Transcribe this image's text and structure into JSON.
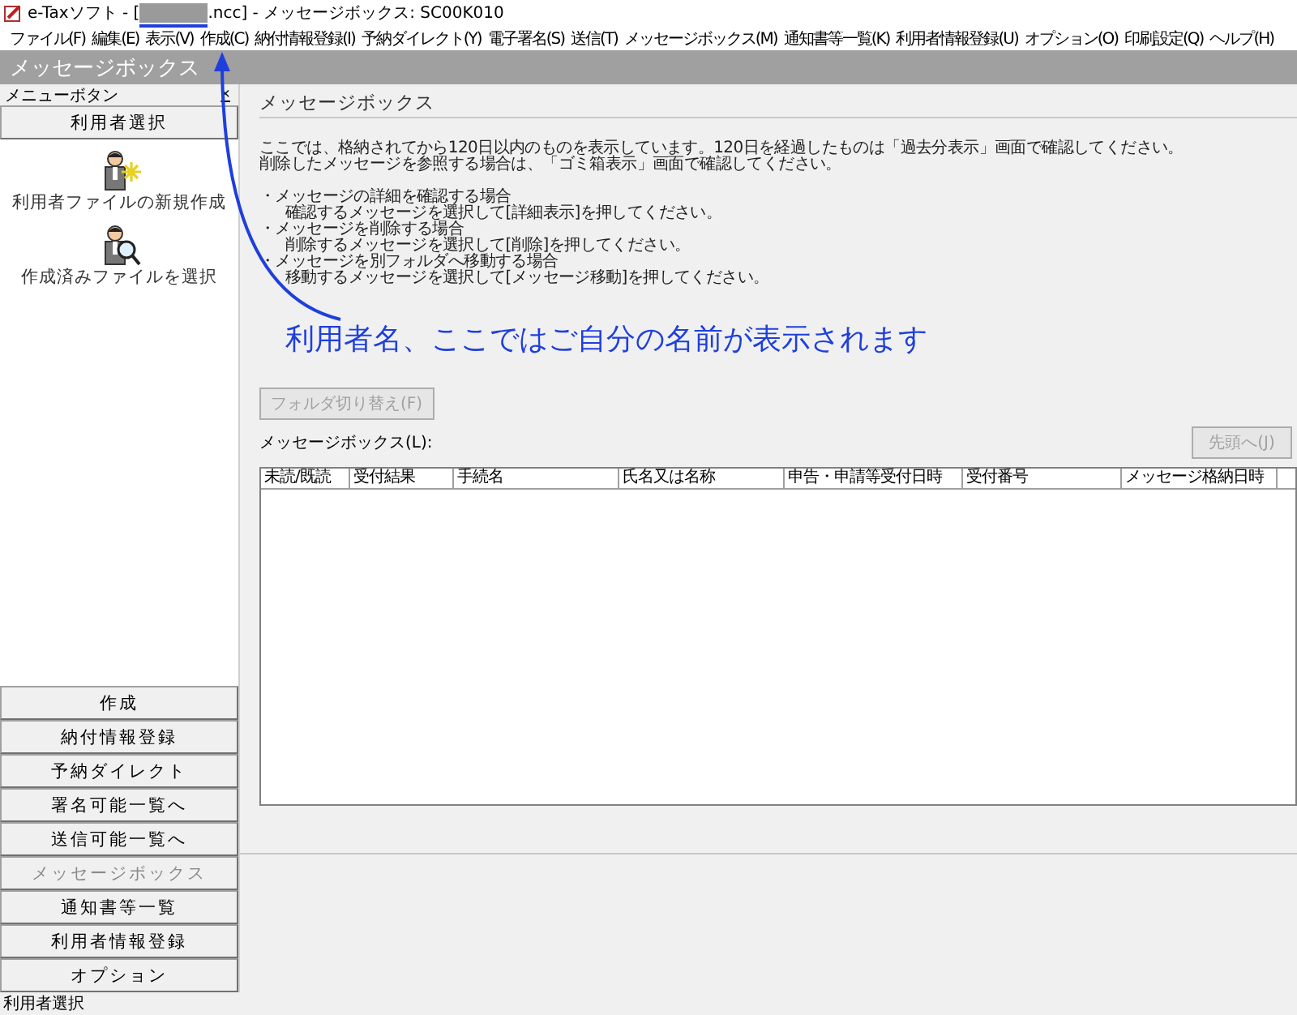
{
  "window": {
    "title_prefix": "e-Taxソフト - [",
    "title_suffix": ".ncc] - メッセージボックス: SC00K010"
  },
  "menu": [
    "ファイル(F)",
    "編集(E)",
    "表示(V)",
    "作成(C)",
    "納付情報登録(I)",
    "予納ダイレクト(Y)",
    "電子署名(S)",
    "送信(T)",
    "メッセージボックス(M)",
    "通知書等一覧(K)",
    "利用者情報登録(U)",
    "オプション(O)",
    "印刷設定(Q)",
    "ヘルプ(H)"
  ],
  "header": "メッセージボックス",
  "sidebar": {
    "label": "メニューボタン",
    "close": "×",
    "top_button": "利用者選択",
    "actions": [
      {
        "kind": "new",
        "label": "利用者ファイルの新規作成"
      },
      {
        "kind": "open",
        "label": "作成済みファイルを選択"
      }
    ],
    "buttons": [
      {
        "label": "作成",
        "disabled": false
      },
      {
        "label": "納付情報登録",
        "disabled": false
      },
      {
        "label": "予納ダイレクト",
        "disabled": false
      },
      {
        "label": "署名可能一覧へ",
        "disabled": false
      },
      {
        "label": "送信可能一覧へ",
        "disabled": false
      },
      {
        "label": "メッセージボックス",
        "disabled": true
      },
      {
        "label": "通知書等一覧",
        "disabled": false
      },
      {
        "label": "利用者情報登録",
        "disabled": false
      },
      {
        "label": "オプション",
        "disabled": false
      }
    ]
  },
  "main": {
    "title": "メッセージボックス",
    "intro": [
      "ここでは、格納されてから120日以内のものを表示しています。120日を経過したものは「過去分表示」画面で確認してください。",
      "削除したメッセージを参照する場合は、「ゴミ箱表示」画面で確認してください。"
    ],
    "bullets": [
      {
        "heading": "・メッセージの詳細を確認する場合",
        "detail": "確認するメッセージを選択して[詳細表示]を押してください。"
      },
      {
        "heading": "・メッセージを削除する場合",
        "detail": "削除するメッセージを選択して[削除]を押してください。"
      },
      {
        "heading": "・メッセージを別フォルダへ移動する場合",
        "detail": "移動するメッセージを選択して[メッセージ移動]を押してください。"
      }
    ],
    "folder_button": {
      "label": "フォルダ切り替え(F)",
      "disabled": true
    },
    "list_label": "メッセージボックス(L):",
    "top_button": {
      "label": "先頭へ(J)",
      "disabled": true
    },
    "table": {
      "columns": [
        "未読/既読",
        "受付結果",
        "手続名",
        "氏名又は名称",
        "申告・申請等受付日時",
        "受付番号",
        "メッセージ格納日時"
      ]
    }
  },
  "annotation": {
    "text": "利用者名、ここではご自分の名前が表示されます"
  },
  "status_bar": "利用者選択"
}
